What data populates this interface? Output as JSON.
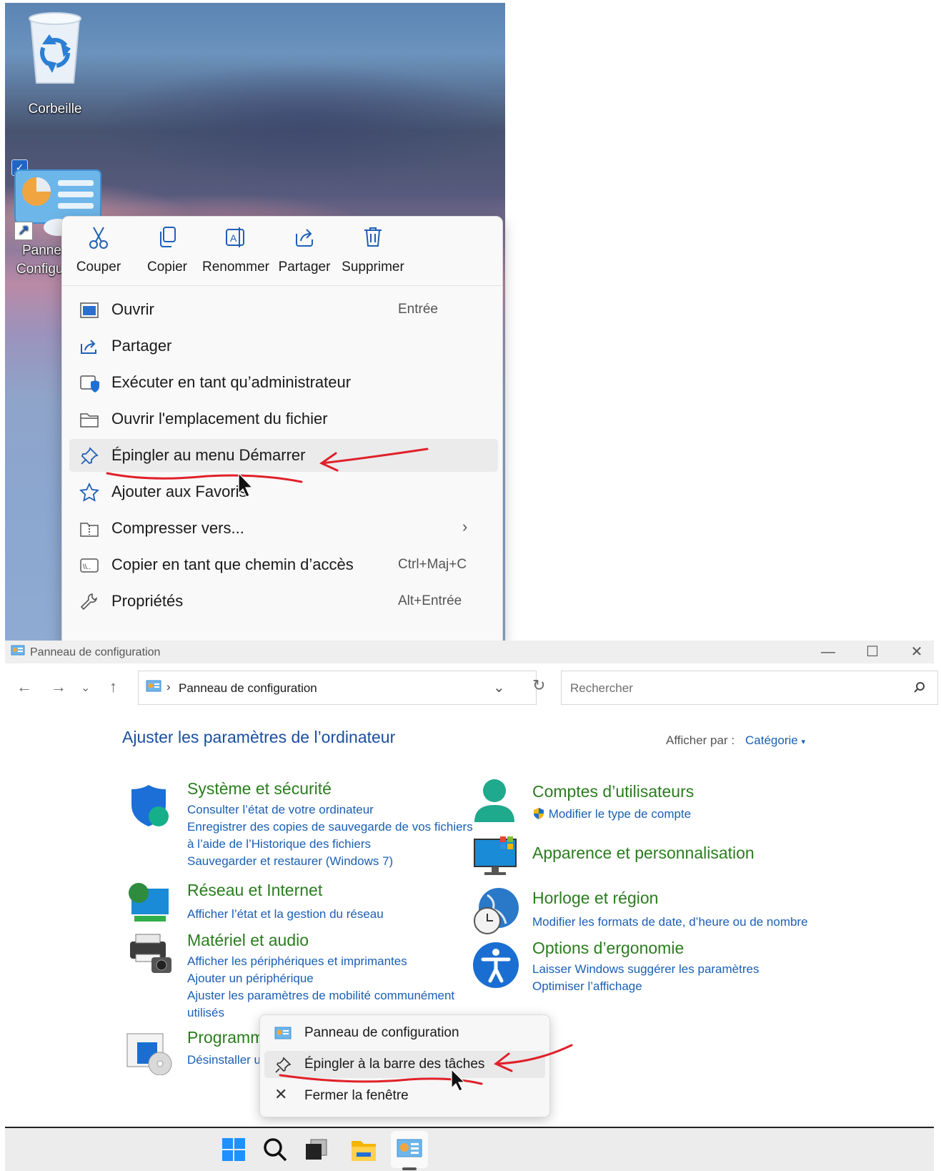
{
  "desktop": {
    "recycle_bin_label": "Corbeille",
    "shortcut_label_line1": "Pannea",
    "shortcut_label_line2": "Configu"
  },
  "context_menu": {
    "toolbar": [
      "Couper",
      "Copier",
      "Renommer",
      "Partager",
      "Supprimer"
    ],
    "items": [
      {
        "label": "Ouvrir",
        "shortcut": "Entrée",
        "icon": "window-icon"
      },
      {
        "label": "Partager",
        "shortcut": "",
        "icon": "share-icon"
      },
      {
        "label": "Exécuter en tant qu’administrateur",
        "shortcut": "",
        "icon": "shield-icon"
      },
      {
        "label": "Ouvrir l'emplacement du fichier",
        "shortcut": "",
        "icon": "folder-icon"
      },
      {
        "label": "Épingler au menu Démarrer",
        "shortcut": "",
        "icon": "pin-icon"
      },
      {
        "label": "Ajouter aux Favoris",
        "shortcut": "",
        "icon": "star-icon"
      },
      {
        "label": "Compresser vers...",
        "shortcut": "",
        "icon": "zip-icon"
      },
      {
        "label": "Copier en tant que chemin d’accès",
        "shortcut": "Ctrl+Maj+C",
        "icon": "path-icon"
      },
      {
        "label": "Propriétés",
        "shortcut": "Alt+Entrée",
        "icon": "wrench-icon"
      }
    ]
  },
  "window": {
    "title": "Panneau de configuration",
    "breadcrumb": "Panneau de configuration",
    "search_placeholder": "Rechercher"
  },
  "control_panel": {
    "heading": "Ajuster les paramètres de l’ordinateur",
    "view_by_label": "Afficher par :",
    "view_by_value": "Catégorie",
    "categories": [
      {
        "title": "Système et sécurité",
        "links": [
          "Consulter l’état de votre ordinateur",
          "Enregistrer des copies de sauvegarde de vos fichiers",
          "à l’aide de l’Historique des fichiers",
          "Sauvegarder et restaurer (Windows 7)"
        ]
      },
      {
        "title": "Réseau et Internet",
        "links": [
          "Afficher l’état et la gestion du réseau"
        ]
      },
      {
        "title": "Matériel et audio",
        "links": [
          "Afficher les périphériques et imprimantes",
          "Ajouter un périphérique",
          "Ajuster les paramètres de mobilité communément",
          "utilisés"
        ]
      },
      {
        "title": "Programm",
        "links": [
          "Désinstaller ur"
        ]
      },
      {
        "title": "Comptes d’utilisateurs",
        "links": [
          "Modifier le type de compte"
        ]
      },
      {
        "title": "Apparence et personnalisation",
        "links": []
      },
      {
        "title": "Horloge et région",
        "links": [
          "Modifier les formats de date, d’heure ou de nombre"
        ]
      },
      {
        "title": "Options d’ergonomie",
        "links": [
          "Laisser Windows suggérer les paramètres",
          "Optimiser l’affichage"
        ]
      }
    ]
  },
  "jump_list": {
    "items": [
      "Panneau de configuration",
      "Épingler à la barre des tâches",
      "Fermer la fenêtre"
    ]
  },
  "taskbar": {
    "icons": [
      "windows-start-icon",
      "search-icon",
      "task-view-icon",
      "file-explorer-icon",
      "control-panel-icon"
    ]
  },
  "colors": {
    "category_title": "#2a7d1e",
    "link": "#1a5fb4",
    "heading": "#1a4e9f",
    "annotation_red": "#e0202a"
  }
}
